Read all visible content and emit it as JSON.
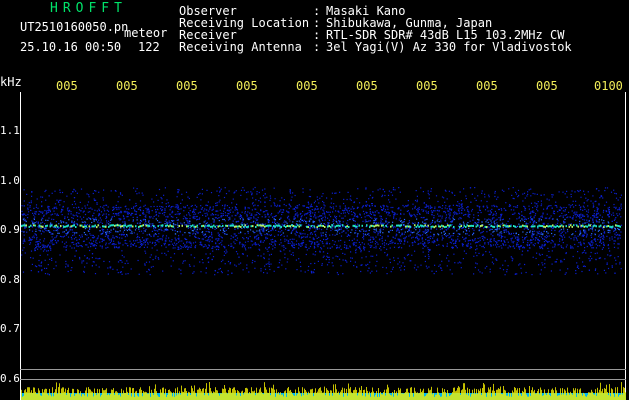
{
  "header": {
    "app_title": "HROFFT",
    "filename": "UT2510160050.pn",
    "mode_label": "meteor",
    "datetime": "25.10.16 00:50",
    "count": "122"
  },
  "station_info": [
    {
      "label": "Observer",
      "value": "Masaki Kano"
    },
    {
      "label": "Receiving Location",
      "value": "Shibukawa, Gunma, Japan"
    },
    {
      "label": "Receiver",
      "value": "RTL-SDR SDR# 43dB L15 103.2MHz CW"
    },
    {
      "label": "Receiving Antenna",
      "value": "3el Yagi(V) Az 330 for Vladivostok"
    }
  ],
  "spectrogram": {
    "y_unit": "kHz",
    "y_ticks": [
      "1.1",
      "1.0",
      "0.9",
      "0.8",
      "0.7",
      "0.6"
    ],
    "time_ticks": [
      "005",
      "005",
      "005",
      "005",
      "005",
      "005",
      "005",
      "005",
      "005",
      "0100"
    ],
    "band_khz": [
      0.79,
      0.99
    ],
    "center_khz": 0.908,
    "colors": {
      "background": "#000000",
      "noise_dark": "#0a1fd0",
      "noise_light": "#2a6bff",
      "carrier": "#1fe0c0",
      "title": "#00e36a",
      "time_ticks": "#f2ee59",
      "level_bars": "#f4f000",
      "level_floor": "#00b8f0",
      "axis": "#ffffff"
    }
  }
}
